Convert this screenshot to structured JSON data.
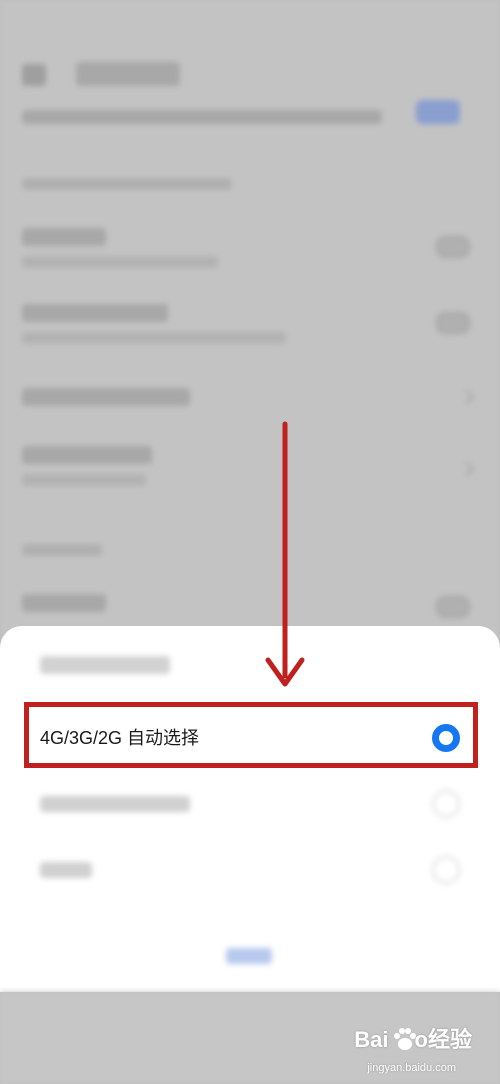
{
  "dialog": {
    "options": [
      {
        "label": "4G/3G/2G 自动选择",
        "selected": true
      },
      {
        "label": "",
        "selected": false
      },
      {
        "label": "",
        "selected": false
      }
    ]
  },
  "colors": {
    "accent": "#1677f2",
    "annotation": "#c0211e",
    "overlay": "#bdbdbd"
  },
  "watermark": {
    "brand_latin": "Bai",
    "brand_latin_tail": "o",
    "brand_cn": "经验",
    "url": "jingyan.baidu.com"
  }
}
